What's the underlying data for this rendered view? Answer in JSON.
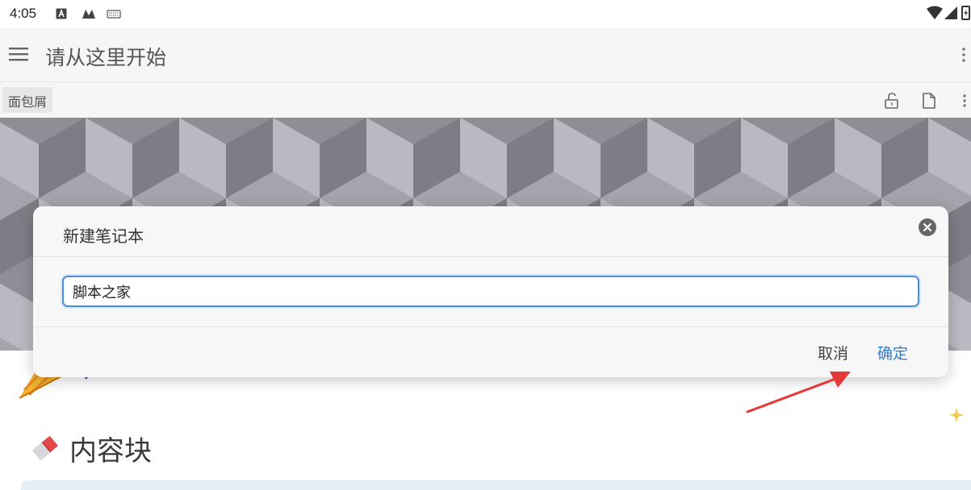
{
  "status_bar": {
    "time": "4:05",
    "left_icons": [
      "a-box-icon",
      "m-icon",
      "keyboard-icon"
    ],
    "right_icons": [
      "wifi-icon",
      "signal-icon",
      "battery-icon"
    ]
  },
  "app_bar": {
    "title": "请从这里开始"
  },
  "breadcrumb": {
    "label": "面包屑"
  },
  "content": {
    "block_heading": "内容块"
  },
  "dialog": {
    "title": "新建笔记本",
    "input_value": "脚本之家",
    "cancel_label": "取消",
    "confirm_label": "确定"
  },
  "colors": {
    "accent": "#2f7cd3",
    "input_border": "#4a90e2",
    "annotation_arrow": "#e53935"
  }
}
